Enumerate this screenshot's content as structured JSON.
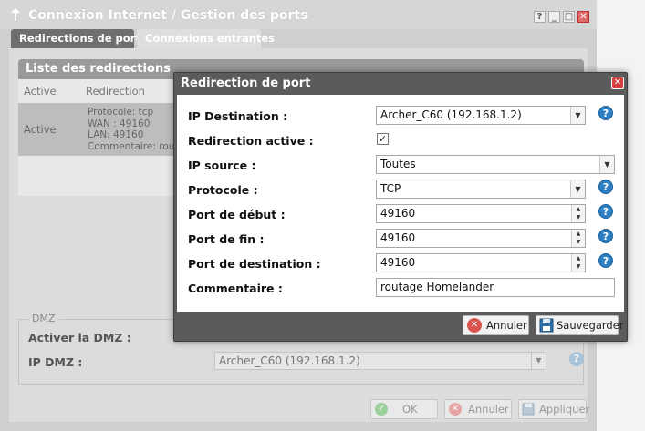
{
  "window": {
    "title": "Connexion Internet / Gestion des ports",
    "controls": [
      "?",
      "_",
      "□",
      "✕"
    ]
  },
  "tabs": [
    {
      "label": "Redirections de ports",
      "active": true
    },
    {
      "label": "Connexions entrantes",
      "active": false
    }
  ],
  "list": {
    "title": "Liste des redirections",
    "columns": [
      "Active",
      "Redirection"
    ],
    "rows": [
      {
        "active": "Active",
        "redirection_lines": [
          "Protocole: tcp",
          "WAN : 49160",
          "LAN: 49160",
          "Commentaire: rout"
        ]
      }
    ]
  },
  "dmz": {
    "legend": "DMZ",
    "enable_label": "Activer la DMZ :",
    "ip_label": "IP DMZ :",
    "ip_value": "Archer_C60 (192.168.1.2)"
  },
  "footer": {
    "ok": "OK",
    "cancel": "Annuler",
    "apply": "Appliquer"
  },
  "modal": {
    "title": "Redirection de port",
    "fields": {
      "ip_destination": {
        "label": "IP Destination :",
        "value": "Archer_C60 (192.168.1.2)"
      },
      "redirection_active": {
        "label": "Redirection active :",
        "checked": true
      },
      "ip_source": {
        "label": "IP source :",
        "value": "Toutes"
      },
      "protocole": {
        "label": "Protocole :",
        "value": "TCP"
      },
      "port_debut": {
        "label": "Port de début :",
        "value": "49160"
      },
      "port_fin": {
        "label": "Port de fin :",
        "value": "49160"
      },
      "port_destination": {
        "label": "Port de destination :",
        "value": "49160"
      },
      "commentaire": {
        "label": "Commentaire :",
        "value": "routage Homelander"
      }
    },
    "buttons": {
      "cancel": "Annuler",
      "save": "Sauvegarder"
    }
  },
  "colors": {
    "help_icon": "#2d7fc4",
    "close_red": "#d34040",
    "modal_frame": "#5b5b5b",
    "ok_green": "#5cb85c",
    "cancel_red": "#d9534f"
  },
  "icons": {
    "help": "?",
    "close": "✕",
    "dropdown": "▼",
    "spin_up": "▲",
    "spin_down": "▼",
    "check": "✓"
  }
}
